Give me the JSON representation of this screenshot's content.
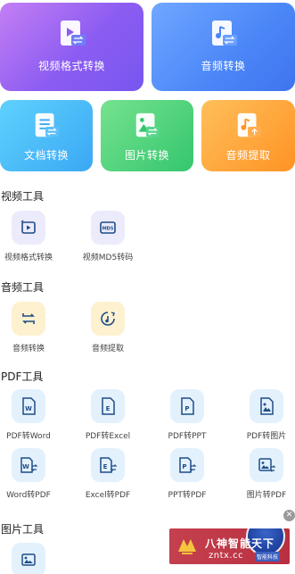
{
  "cards": {
    "video_format": "视频格式转换",
    "audio_convert": "音频转换",
    "doc_convert": "文档转换",
    "image_convert": "图片转换",
    "audio_extract": "音频提取"
  },
  "sections": {
    "video_tools": {
      "title": "视频工具",
      "items": [
        "视频格式转换",
        "视频MD5转码"
      ]
    },
    "audio_tools": {
      "title": "音频工具",
      "items": [
        "音频转换",
        "音频提取"
      ]
    },
    "pdf_tools": {
      "title": "PDF工具",
      "row1": [
        "PDF转Word",
        "PDF转Excel",
        "PDF转PPT",
        "PDF转图片"
      ],
      "row2": [
        "Word转PDF",
        "Excel转PDF",
        "PPT转PDF",
        "图片转PDF"
      ]
    },
    "image_tools": {
      "title": "图片工具"
    }
  },
  "ad": {
    "brand": "八神智能天下",
    "site": "zntx.cc",
    "badge": "智能科技"
  },
  "icons": {
    "tile_letters": [
      "W",
      "E",
      "P",
      "W",
      "E",
      "P"
    ],
    "md5_text": "MD5"
  },
  "colors": {
    "purple": "#8c5cf2",
    "blue": "#4b86f8",
    "cyan": "#3ba8f4",
    "green": "#34c66e",
    "orange": "#ff9325",
    "icon_blue": "#1e4c87"
  }
}
